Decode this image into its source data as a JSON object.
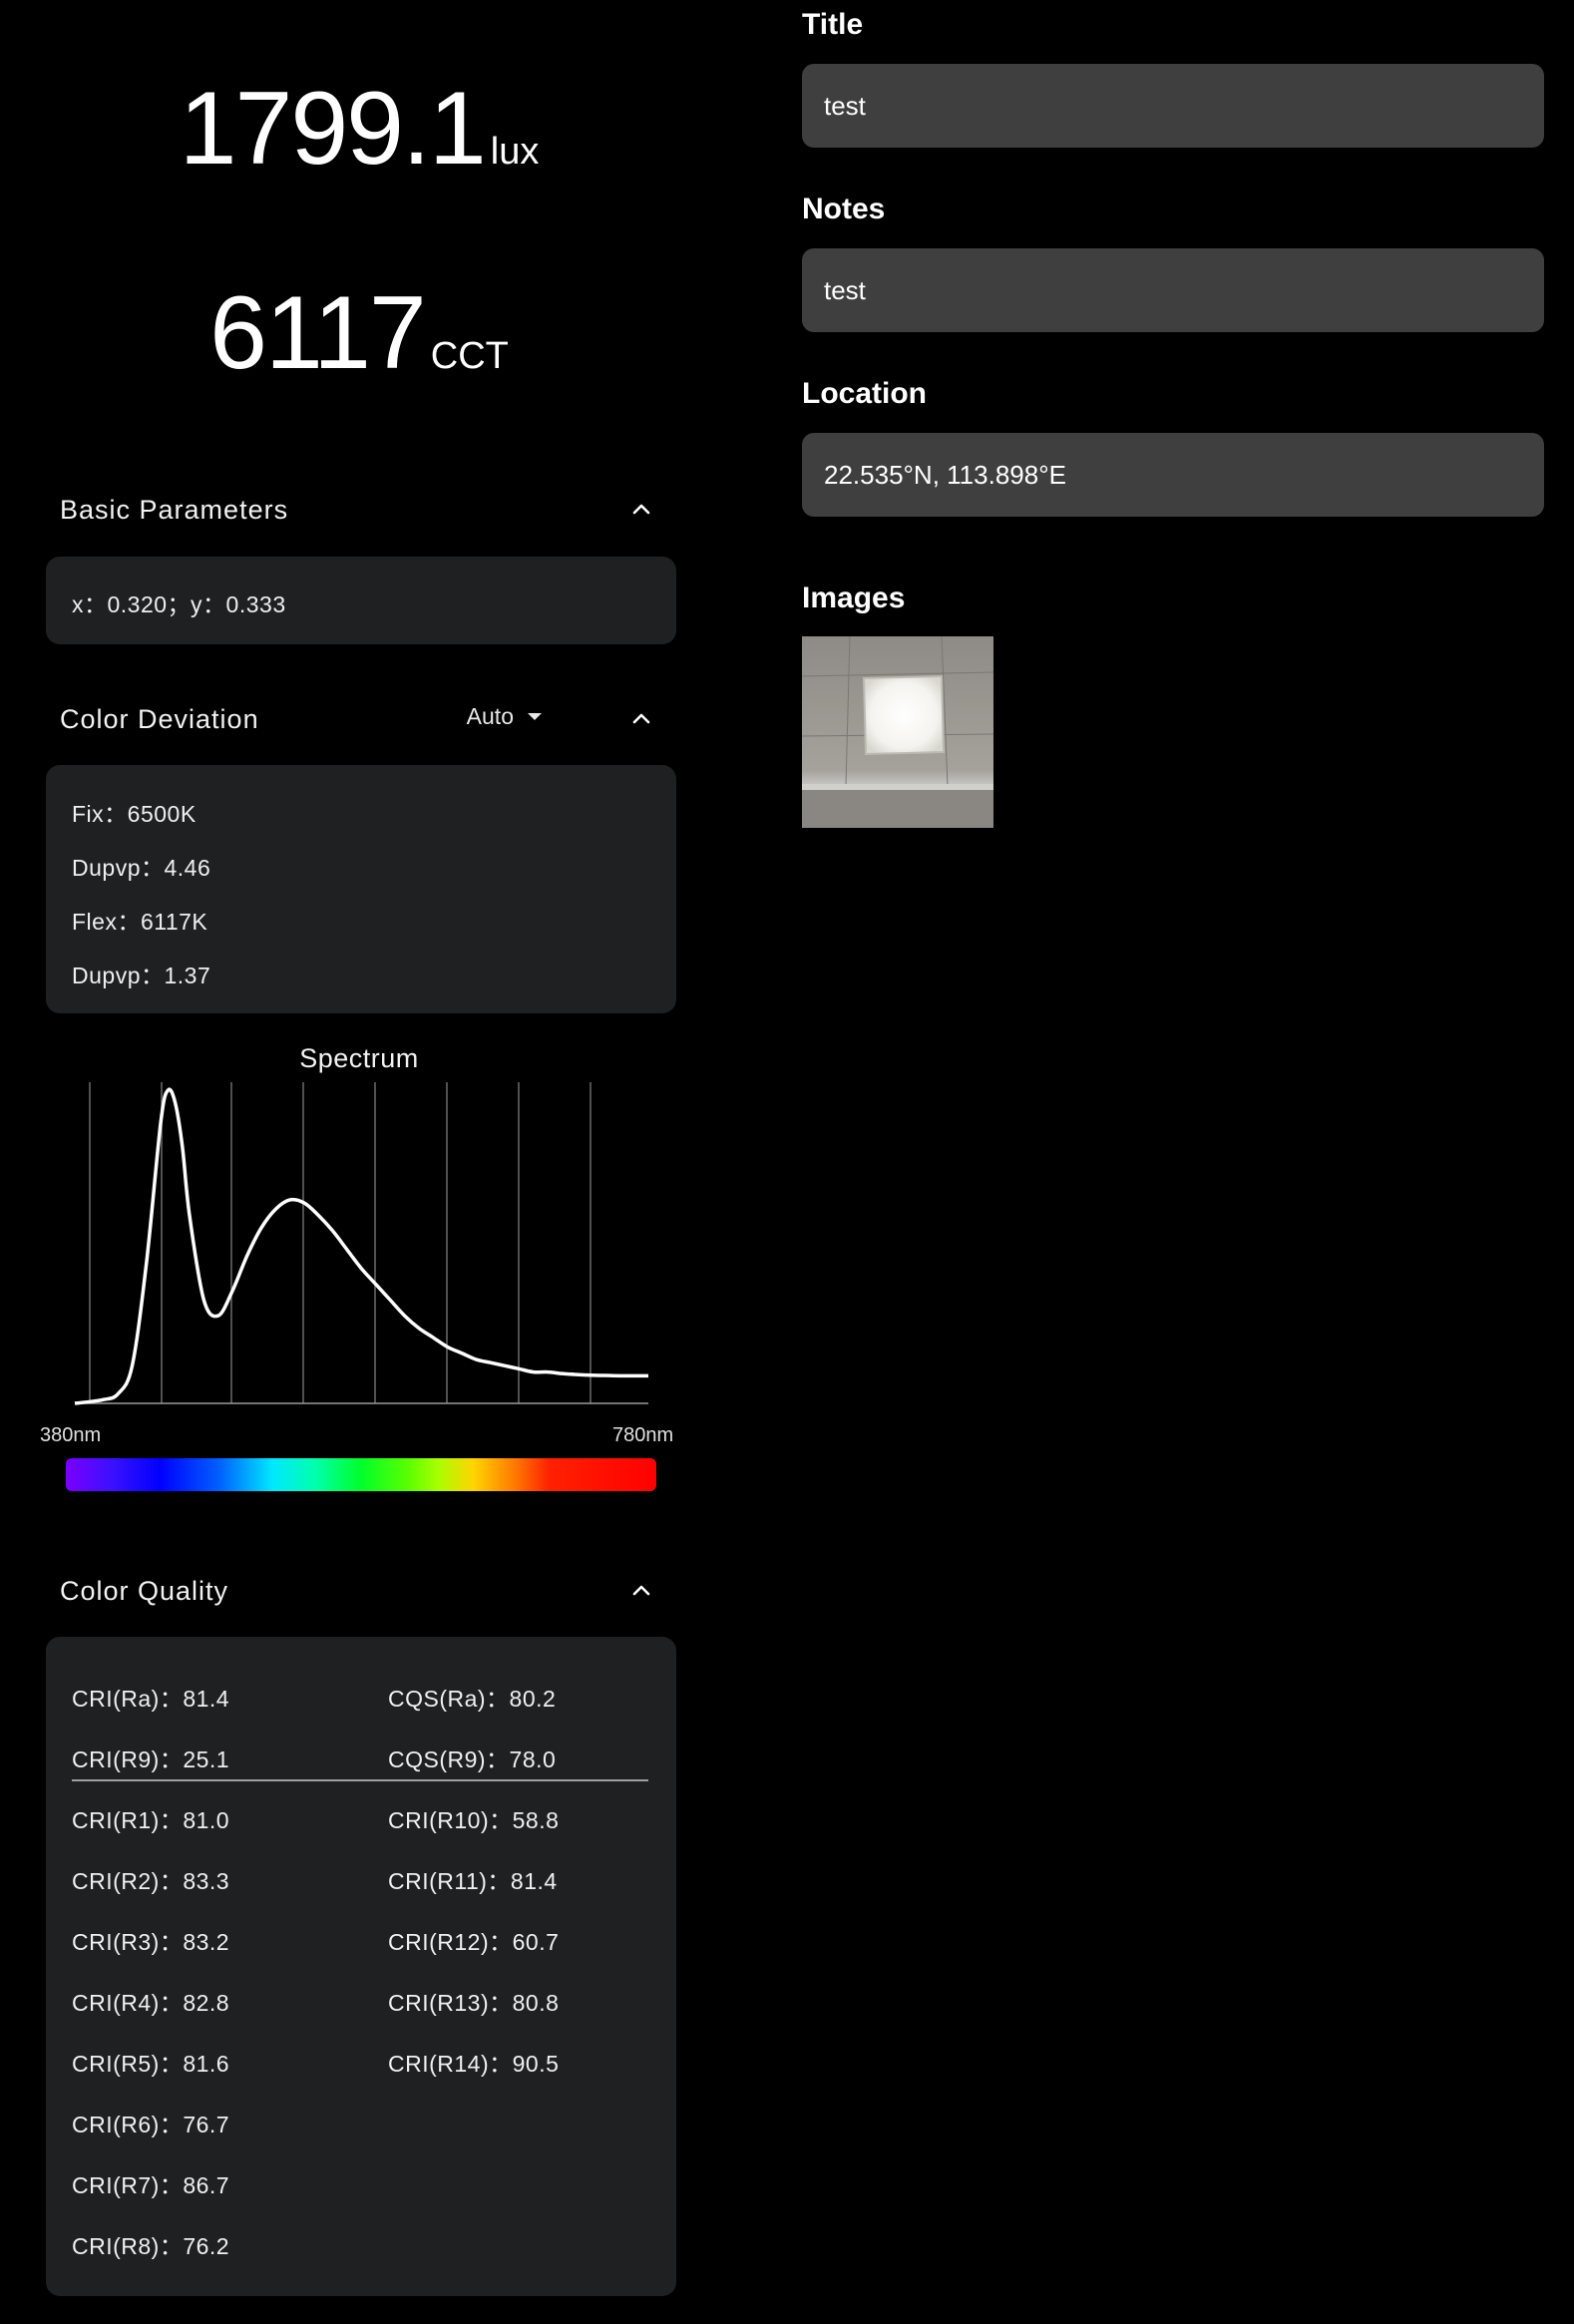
{
  "readings": {
    "lux_value": "1799.1",
    "lux_unit": "lux",
    "cct_value": "6117",
    "cct_unit": "CCT"
  },
  "basic": {
    "header": "Basic Parameters",
    "xy": "x：0.320；y：0.333"
  },
  "deviation": {
    "header": "Color Deviation",
    "mode": "Auto",
    "rows": [
      "Fix：6500K",
      "Dupvp：4.46",
      "Flex：6117K",
      "Dupvp：1.37"
    ]
  },
  "spectrum": {
    "title": "Spectrum",
    "x_start_label": "380nm",
    "x_end_label": "780nm"
  },
  "chart_data": {
    "type": "line",
    "title": "Spectrum",
    "xlabel": "",
    "ylabel": "",
    "xlim": [
      380,
      780
    ],
    "ylim": [
      0,
      1
    ],
    "grid": true,
    "x": [
      380,
      390,
      400,
      410,
      420,
      430,
      440,
      445,
      450,
      455,
      460,
      470,
      480,
      490,
      500,
      510,
      520,
      530,
      540,
      550,
      560,
      570,
      580,
      590,
      600,
      610,
      620,
      630,
      640,
      650,
      660,
      670,
      680,
      690,
      700,
      710,
      720,
      730,
      740,
      750,
      760,
      770,
      780
    ],
    "series": [
      {
        "values": [
          0.0,
          0.005,
          0.012,
          0.03,
          0.12,
          0.45,
          0.9,
          1.0,
          0.96,
          0.82,
          0.6,
          0.33,
          0.28,
          0.36,
          0.47,
          0.56,
          0.62,
          0.65,
          0.64,
          0.6,
          0.55,
          0.49,
          0.43,
          0.38,
          0.33,
          0.28,
          0.24,
          0.21,
          0.18,
          0.16,
          0.14,
          0.13,
          0.12,
          0.11,
          0.1,
          0.1,
          0.095,
          0.092,
          0.09,
          0.089,
          0.088,
          0.088,
          0.088
        ]
      }
    ]
  },
  "quality": {
    "header": "Color Quality",
    "left_top": [
      "CRI(Ra)：81.4",
      "CRI(R9)：25.1"
    ],
    "right_top": [
      "CQS(Ra)：80.2",
      "CQS(R9)：78.0"
    ],
    "left": [
      "CRI(R1)：81.0",
      "CRI(R2)：83.3",
      "CRI(R3)：83.2",
      "CRI(R4)：82.8",
      "CRI(R5)：81.6",
      "CRI(R6)：76.7",
      "CRI(R7)：86.7",
      "CRI(R8)：76.2"
    ],
    "right": [
      "CRI(R10)：58.8",
      "CRI(R11)：81.4",
      "CRI(R12)：60.7",
      "CRI(R13)：80.8",
      "CRI(R14)：90.5"
    ]
  },
  "form": {
    "title_label": "Title",
    "title_value": "test",
    "notes_label": "Notes",
    "notes_value": "test",
    "location_label": "Location",
    "location_value": "22.535°N, 113.898°E",
    "images_label": "Images"
  },
  "icons": {
    "collapse": "chevron-up-icon",
    "dropdown": "caret-down-icon"
  }
}
